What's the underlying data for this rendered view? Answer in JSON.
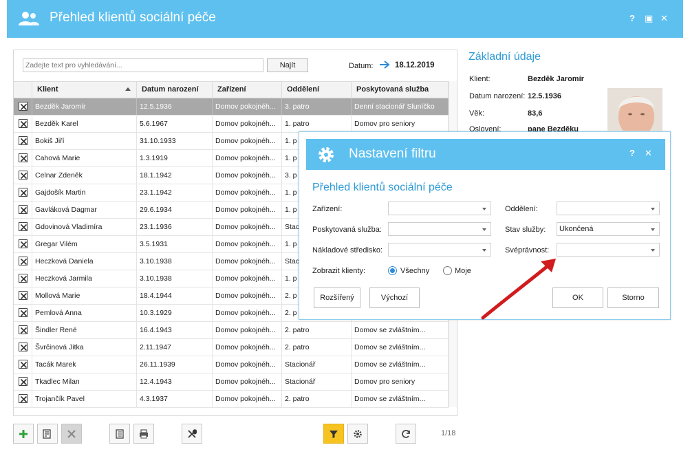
{
  "window": {
    "title": "Přehled klientů sociální péče",
    "help": "?",
    "maximize": "▣",
    "close": "✕"
  },
  "search": {
    "placeholder": "Zadejte text pro vyhledávání...",
    "button": "Najít",
    "date_label": "Datum:",
    "date_value": "18.12.2019"
  },
  "grid": {
    "columns": [
      "Klient",
      "Datum narození",
      "Zařízení",
      "Oddělení",
      "Poskytovaná služba"
    ],
    "rows": [
      [
        "Bezděk Jaromír",
        "12.5.1936",
        "Domov pokojnéh...",
        "3. patro",
        "Denní stacionář Sluníčko"
      ],
      [
        "Bezděk Karel",
        "5.6.1967",
        "Domov pokojnéh...",
        "1. patro",
        "Domov pro seniory"
      ],
      [
        "Bokiš Jiří",
        "31.10.1933",
        "Domov pokojnéh...",
        "1. p",
        ""
      ],
      [
        "Cahová Marie",
        "1.3.1919",
        "Domov pokojnéh...",
        "1. p",
        ""
      ],
      [
        "Celnar Zdeněk",
        "18.1.1942",
        "Domov pokojnéh...",
        "3. p",
        ""
      ],
      [
        "Gajdošík Martin",
        "23.1.1942",
        "Domov pokojnéh...",
        "1. p",
        ""
      ],
      [
        "Gavláková Dagmar",
        "29.6.1934",
        "Domov pokojnéh...",
        "1. p",
        ""
      ],
      [
        "Gdovinová Vladimíra",
        "23.1.1936",
        "Domov pokojnéh...",
        "Stac",
        ""
      ],
      [
        "Gregar Vilém",
        "3.5.1931",
        "Domov pokojnéh...",
        "1. p",
        ""
      ],
      [
        "Heczková Daniela",
        "3.10.1938",
        "Domov pokojnéh...",
        "Stac",
        ""
      ],
      [
        "Heczková Jarmila",
        "3.10.1938",
        "Domov pokojnéh...",
        "1. p",
        ""
      ],
      [
        "Mollová Marie",
        "18.4.1944",
        "Domov pokojnéh...",
        "2. p",
        ""
      ],
      [
        "Pemlová Anna",
        "10.3.1929",
        "Domov pokojnéh...",
        "2. p",
        ""
      ],
      [
        "Šindler René",
        "16.4.1943",
        "Domov pokojnéh...",
        "2. patro",
        "Domov se zvláštním..."
      ],
      [
        "Švrčinová Jitka",
        "2.11.1947",
        "Domov pokojnéh...",
        "2. patro",
        "Domov se zvláštním..."
      ],
      [
        "Tacák Marek",
        "26.11.1939",
        "Domov pokojnéh...",
        "Stacionář",
        "Domov se zvláštním..."
      ],
      [
        "Tkadlec Milan",
        "12.4.1943",
        "Domov pokojnéh...",
        "Stacionář",
        "Domov pro seniory"
      ],
      [
        "Trojančík Pavel",
        "4.3.1937",
        "Domov pokojnéh...",
        "2. patro",
        "Domov se zvláštním..."
      ]
    ]
  },
  "details": {
    "title": "Základní údaje",
    "client_label": "Klient:",
    "client_value": "Bezděk Jaromír",
    "birth_label": "Datum narození:",
    "birth_value": "12.5.1936",
    "age_label": "Věk:",
    "age_value": "83,6",
    "address_label": "Oslovení:",
    "address_value": "pane Bezděku"
  },
  "toolbar": {
    "pager": "1/18"
  },
  "dialog": {
    "title": "Nastavení filtru",
    "help": "?",
    "close": "✕",
    "subtitle": "Přehled klientů sociální péče",
    "facility_label": "Zařízení:",
    "facility_value": "",
    "department_label": "Oddělení:",
    "department_value": "",
    "service_label": "Poskytovaná služba:",
    "service_value": "",
    "service_state_label": "Stav služby:",
    "service_state_value": "Ukončená",
    "cost_center_label": "Nákladové středisko:",
    "cost_center_value": "",
    "capacity_label": "Svéprávnost:",
    "capacity_value": "",
    "show_clients_label": "Zobrazit klienty:",
    "radio_all": "Všechny",
    "radio_mine": "Moje",
    "btn_advanced": "Rozšířený",
    "btn_default": "Výchozí",
    "btn_ok": "OK",
    "btn_cancel": "Storno"
  },
  "colors": {
    "accent": "#5ec0ef",
    "heading": "#2d9ad6",
    "selected_row": "#a8a8a8",
    "filter_active": "#f6c321",
    "annotation_arrow": "#d01c1f"
  }
}
